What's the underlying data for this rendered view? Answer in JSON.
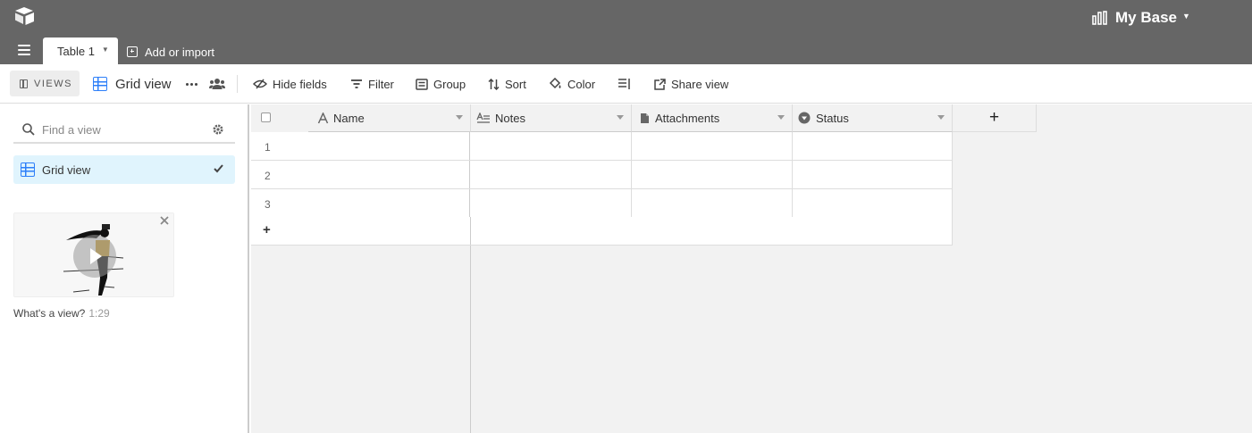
{
  "header": {
    "base_name": "My Base",
    "tab_label": "Table 1",
    "add_import_label": "Add or import"
  },
  "toolbar": {
    "views_label": "VIEWS",
    "current_view": "Grid view",
    "hide_fields": "Hide fields",
    "filter": "Filter",
    "group": "Group",
    "sort": "Sort",
    "color": "Color",
    "share_view": "Share view"
  },
  "sidebar": {
    "search_placeholder": "Find a view",
    "views": [
      {
        "label": "Grid view",
        "selected": true
      }
    ],
    "video": {
      "caption": "What's a view?",
      "duration": "1:29"
    }
  },
  "grid": {
    "columns": [
      {
        "label": "Name",
        "icon": "text-icon"
      },
      {
        "label": "Notes",
        "icon": "long-text-icon"
      },
      {
        "label": "Attachments",
        "icon": "document-icon"
      },
      {
        "label": "Status",
        "icon": "single-select-icon"
      }
    ],
    "rows": [
      {
        "num": "1"
      },
      {
        "num": "2"
      },
      {
        "num": "3"
      }
    ],
    "add_row_label": "+",
    "add_field_label": "+"
  },
  "colors": {
    "header_bg": "#666666",
    "accent": "#2d7ff9",
    "selected_view_bg": "#e0f4fd",
    "grid_bg": "#f2f2f2"
  }
}
